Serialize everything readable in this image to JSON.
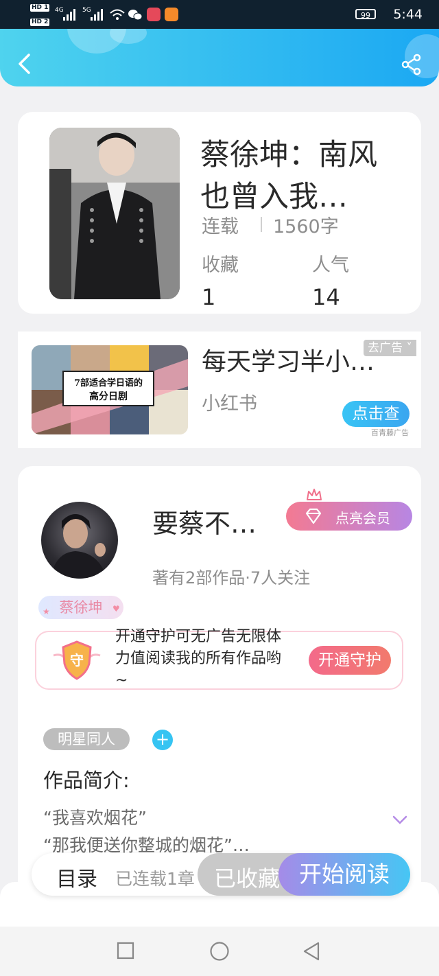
{
  "status_bar": {
    "hd1": "HD 1",
    "hd2": "HD 2",
    "net1": "4G",
    "net2": "5G",
    "battery": "99",
    "time": "5:44"
  },
  "header": {
    "back_icon": "chevron-left-icon",
    "share_icon": "share-icon"
  },
  "book": {
    "title": "蔡徐坤：南风也曾入我…",
    "status": "连载",
    "word_count": "1560字",
    "favorites_label": "收藏",
    "favorites_value": "1",
    "popularity_label": "人气",
    "popularity_value": "14"
  },
  "ad": {
    "thumb_text_line1": "7部适合学日语的",
    "thumb_text_line2": "高分日剧",
    "title": "每天学习半小…",
    "source": "小红书",
    "close_label": "去广告",
    "cta": "点击查",
    "provider": "百青藤广告"
  },
  "author": {
    "name": "要蔡不…",
    "vip_button": "点亮会员",
    "stats": "著有2部作品·7人关注",
    "fan_tag": "蔡徐坤",
    "guard_badge": "守",
    "guard_text": "开通守护可无广告无限体力值阅读我的所有作品哟~",
    "guard_button": "开通守护",
    "tag": "明星同人",
    "intro_title": "作品简介:",
    "intro_line1": "“我喜欢烟花”",
    "intro_line2": "“那我便送你整城的烟花”…"
  },
  "bottom_bar": {
    "catalog": "目录",
    "chapters": "已连载1章",
    "favorited": "已收藏",
    "start_reading": "开始阅读"
  },
  "colors": {
    "header_start": "#4fd3ee",
    "header_end": "#1ba8f3",
    "accent_pink": "#f37a92",
    "accent_purple": "#b786e3",
    "tag_gray": "#bdbdbd"
  }
}
